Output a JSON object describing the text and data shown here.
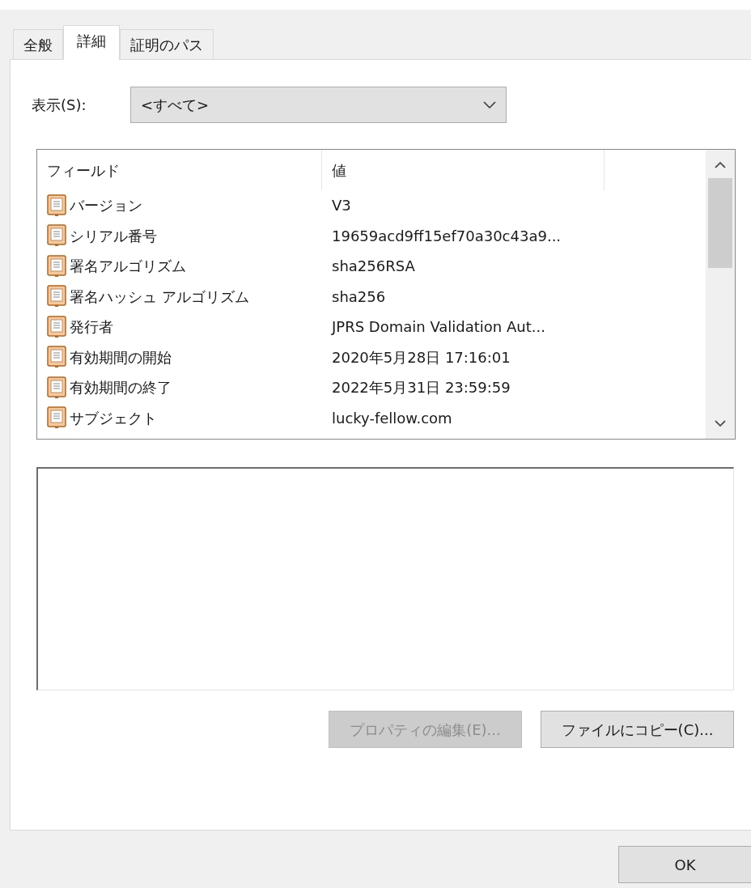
{
  "tabs": [
    {
      "label": "全般",
      "selected": false
    },
    {
      "label": "詳細",
      "selected": true
    },
    {
      "label": "証明のパス",
      "selected": false
    }
  ],
  "show": {
    "label": "表示(S):",
    "value": "<すべて>"
  },
  "list": {
    "columns": [
      "フィールド",
      "値"
    ],
    "rows": [
      {
        "field": "バージョン",
        "value": "V3"
      },
      {
        "field": "シリアル番号",
        "value": "19659acd9ff15ef70a30c43a9..."
      },
      {
        "field": "署名アルゴリズム",
        "value": "sha256RSA"
      },
      {
        "field": "署名ハッシュ アルゴリズム",
        "value": "sha256"
      },
      {
        "field": "発行者",
        "value": "JPRS Domain Validation Aut..."
      },
      {
        "field": "有効期間の開始",
        "value": "2020年5月28日 17:16:01"
      },
      {
        "field": "有効期間の終了",
        "value": "2022年5月31日 23:59:59"
      },
      {
        "field": "サブジェクト",
        "value": "lucky-fellow.com"
      }
    ]
  },
  "buttons": [
    {
      "label": "プロパティの編集(E)...",
      "disabled": true
    },
    {
      "label": "ファイルにコピー(C)...",
      "disabled": false
    }
  ],
  "footer_button": "OK"
}
